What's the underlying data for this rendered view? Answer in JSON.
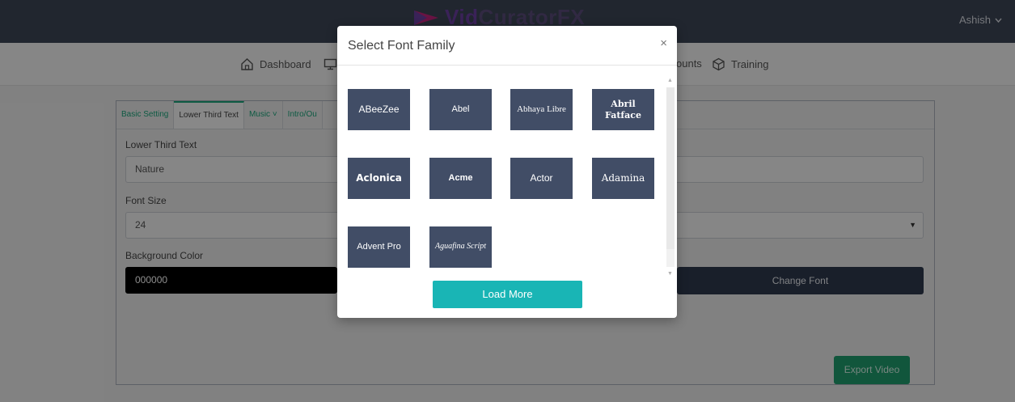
{
  "header": {
    "brand_prefix": "Vid",
    "brand_suffix": "CuratorFX",
    "user_name": "Ashish",
    "user_chevron": "chevron-down-icon"
  },
  "nav": {
    "items": [
      {
        "label": "Dashboard",
        "icon": "home-icon"
      },
      {
        "label": "",
        "icon": "monitor-icon"
      },
      {
        "label": "ounts",
        "icon": ""
      },
      {
        "label": "Training",
        "icon": "cube-icon"
      }
    ]
  },
  "panel": {
    "tabs": [
      {
        "label": "Basic Setting",
        "active": false
      },
      {
        "label": "Lower Third Text",
        "active": true
      },
      {
        "label": "Music ˅",
        "active": false
      },
      {
        "label": "Intro/Ou",
        "active": false
      }
    ],
    "lower_third_text_label": "Lower Third Text",
    "lower_third_text_value": "Nature",
    "font_size_label": "Font Size",
    "font_size_value": "24",
    "background_color_label": "Background Color",
    "background_color_value": "000000",
    "change_font_label": "Change Font",
    "export_label": "Export Video"
  },
  "modal": {
    "title": "Select Font Family",
    "close_label": "×",
    "fonts": [
      {
        "label": "ABeeZee",
        "font": "\"Liberation Sans\", sans-serif",
        "weight": "normal",
        "style": "normal"
      },
      {
        "label": "Abel",
        "font": "\"Liberation Sans\", sans-serif",
        "weight": "normal",
        "style": "normal"
      },
      {
        "label": "Abhaya Libre",
        "font": "\"Liberation Serif\", serif",
        "weight": "normal",
        "style": "normal"
      },
      {
        "label": "Abril Fatface",
        "font": "\"DejaVu Serif\", serif",
        "weight": "bold",
        "style": "normal"
      },
      {
        "label": "Aclonica",
        "font": "\"DejaVu Sans\", sans-serif",
        "weight": "bold",
        "style": "normal"
      },
      {
        "label": "Acme",
        "font": "\"DejaVu Sans\", sans-serif",
        "weight": "bold",
        "style": "normal"
      },
      {
        "label": "Actor",
        "font": "\"Liberation Sans\", sans-serif",
        "weight": "normal",
        "style": "normal"
      },
      {
        "label": "Adamina",
        "font": "\"DejaVu Serif\", serif",
        "weight": "normal",
        "style": "normal"
      },
      {
        "label": "Advent Pro",
        "font": "\"Liberation Sans\", sans-serif",
        "weight": "normal",
        "style": "normal"
      },
      {
        "label": "Aguafina Script",
        "font": "\"Liberation Serif\", serif",
        "weight": "normal",
        "style": "italic"
      }
    ],
    "load_more_label": "Load More"
  },
  "colors": {
    "header_bg": "#3d4556",
    "tile_bg": "#414d66",
    "load_more_bg": "#19b5b5",
    "export_bg": "#1f9d6e",
    "tab_green": "#1aa57b"
  }
}
